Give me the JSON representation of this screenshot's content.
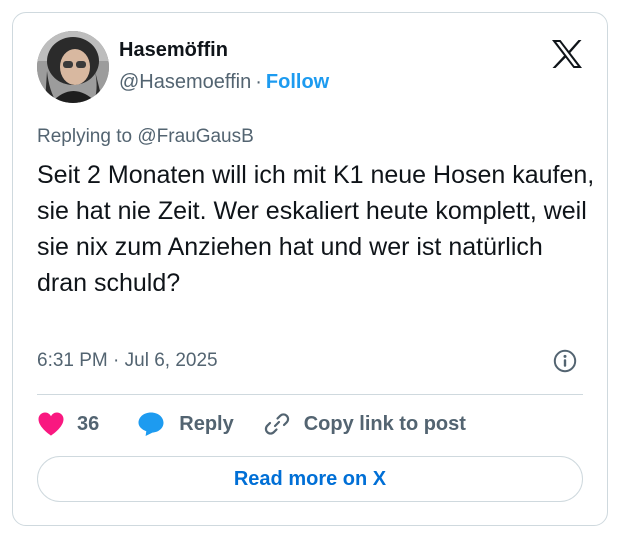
{
  "author": {
    "display_name": "Hasemöffin",
    "handle": "@Hasemoeffin",
    "separator": "·",
    "follow_label": "Follow"
  },
  "reply_context": {
    "prefix": "Replying to",
    "mention": "@FrauGausB"
  },
  "post": {
    "text": "Seit 2 Monaten will ich mit K1 neue Hosen kaufen, sie hat nie Zeit. Wer eskaliert heute komplett, weil sie nix zum Anziehen hat und wer ist natürlich dran schuld?",
    "timestamp": "6:31 PM · Jul 6, 2025"
  },
  "actions": {
    "like_count": "36",
    "reply_label": "Reply",
    "copy_label": "Copy link to post"
  },
  "footer": {
    "read_more_label": "Read more on X"
  },
  "colors": {
    "link": "#1d9bf0",
    "read_more": "#006fd6",
    "like": "#f91880",
    "text": "#0f1419",
    "muted": "#536471",
    "border": "#cfd9de"
  },
  "icons": [
    "x-logo-icon",
    "info-icon",
    "heart-icon",
    "reply-bubble-icon",
    "link-icon"
  ]
}
